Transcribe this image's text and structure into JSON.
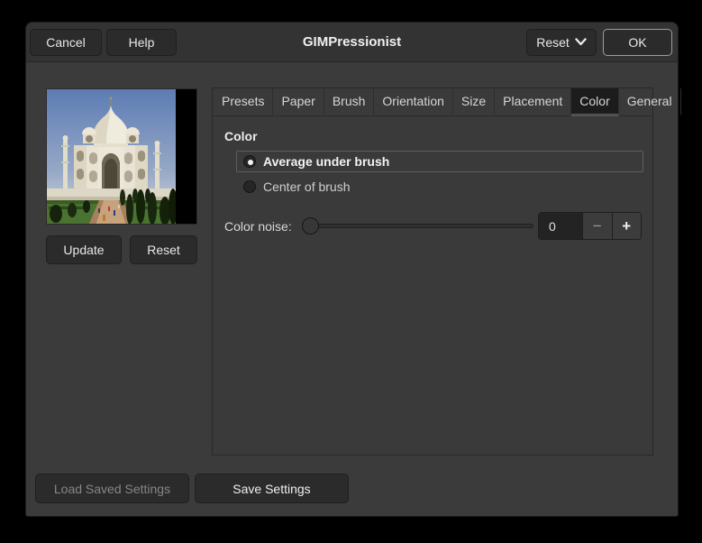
{
  "window": {
    "title": "GIMPressionist"
  },
  "header": {
    "cancel_label": "Cancel",
    "help_label": "Help",
    "reset_label": "Reset",
    "ok_label": "OK"
  },
  "preview": {
    "image_alt": "Taj Mahal preview",
    "update_label": "Update",
    "reset_label": "Reset"
  },
  "tabs": [
    {
      "label": "Presets"
    },
    {
      "label": "Paper"
    },
    {
      "label": "Brush"
    },
    {
      "label": "Orientation"
    },
    {
      "label": "Size"
    },
    {
      "label": "Placement"
    },
    {
      "label": "Color",
      "selected": true
    },
    {
      "label": "General"
    }
  ],
  "color_panel": {
    "header": "Color",
    "options": [
      {
        "label": "Average under brush",
        "selected": true
      },
      {
        "label": "Center of brush",
        "selected": false
      }
    ],
    "noise": {
      "label": "Color noise:",
      "value": "0",
      "minus": "−",
      "plus": "+"
    }
  },
  "footer": {
    "load_label": "Load Saved Settings",
    "save_label": "Save Settings"
  },
  "colors": {
    "outside_bg": "#000000",
    "dialog_bg": "#3b3b3b",
    "header_bg": "#333334",
    "button_bg": "#2b2b2b",
    "selected_tab_bg": "#1c1c1c",
    "ok_border": "#9d9d9d"
  }
}
